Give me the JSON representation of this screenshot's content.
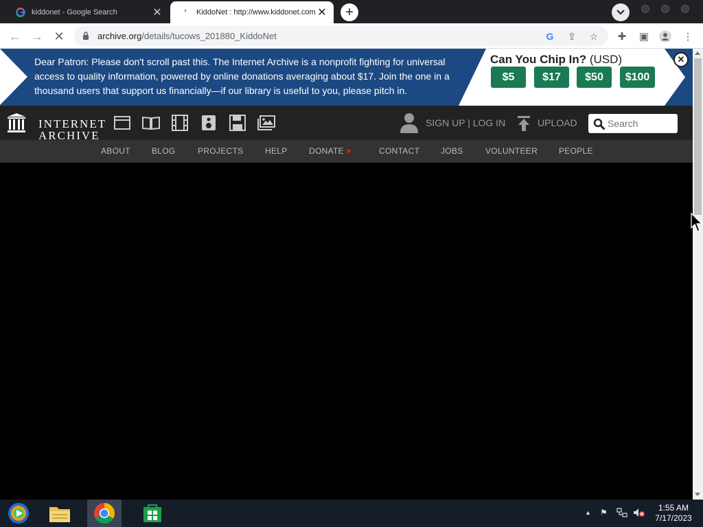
{
  "browser": {
    "tabs": [
      {
        "title": "kiddonet - Google Search",
        "favicon": "google-g-icon",
        "active": false
      },
      {
        "title": "KiddoNet : http://www.kiddonet.com",
        "favicon": "archive-icon",
        "active": true
      }
    ],
    "url_host": "archive.org",
    "url_path": "/details/tucows_201880_KiddoNet"
  },
  "banner": {
    "message": "Dear Patron: Please don't scroll past this. The Internet Archive is a nonprofit fighting for universal access to quality information, powered by online donations averaging about $17. Join the one in a thousand users that support us financially—if our library is useful to you, please pitch in.",
    "chip_title": "Can You Chip In?",
    "chip_currency": "(USD)",
    "amounts": [
      "$5",
      "$17",
      "$50",
      "$100"
    ]
  },
  "header": {
    "logo_line1": "INTERNET",
    "logo_line2": "ARCHIVE",
    "signup_login": "SIGN UP | LOG IN",
    "upload": "UPLOAD",
    "search_placeholder": "Search"
  },
  "nav": [
    "ABOUT",
    "BLOG",
    "PROJECTS",
    "HELP",
    "DONATE",
    "CONTACT",
    "JOBS",
    "VOLUNTEER",
    "PEOPLE"
  ],
  "taskbar": {
    "time": "1:55 AM",
    "date": "7/17/2023"
  },
  "colors": {
    "banner_blue": "#1c4982",
    "donate_green": "#1a7a53",
    "header_bg": "#222222",
    "nav_bg": "#333333",
    "taskbar_bg": "#151d28"
  }
}
